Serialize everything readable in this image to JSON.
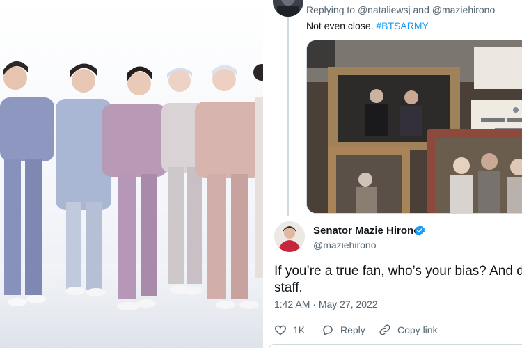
{
  "reply_context": {
    "prefix": "Replying to",
    "handle_1": "@nataliewsj",
    "conjunction": "and",
    "handle_2": "@maziehirono"
  },
  "reply_tweet": {
    "text": "Not even close.",
    "hashtag": "#BTSARMY"
  },
  "main_tweet": {
    "author_name": "Senator Mazie Hirono",
    "author_handle": "@maziehirono",
    "verified": true,
    "text_line_1": "If you’re a true fan, who’s your bias? And do",
    "text_line_2": "staff.",
    "time": "1:42 AM",
    "separator": "·",
    "date": "May 27, 2022"
  },
  "actions": {
    "like_count": "1K",
    "reply_label": "Reply",
    "copy_link_label": "Copy link"
  },
  "colors": {
    "accent": "#1d9bf0",
    "text_primary": "#0f1419",
    "text_secondary": "#536471",
    "border": "#cfd9de"
  },
  "icons": [
    "heart-icon",
    "reply-icon",
    "link-icon",
    "verified-badge-icon"
  ]
}
